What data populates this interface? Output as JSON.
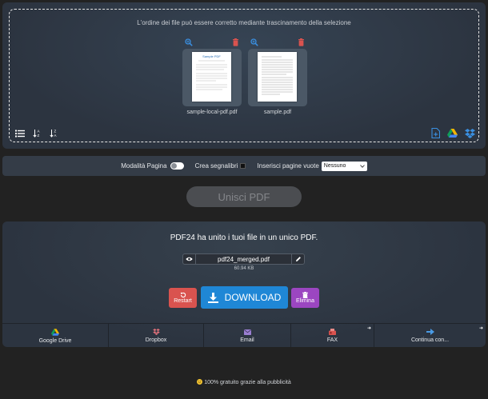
{
  "dropzone": {
    "instruction": "L'ordine dei file può essere corretto mediante trascinamento della selezione",
    "files": [
      {
        "name": "sample-local-pdf.pdf",
        "preview_title": "Sample PDF"
      },
      {
        "name": "sample.pdf",
        "preview_title": ""
      }
    ],
    "left_tools": [
      "list-view-icon",
      "sort-ascending-icon",
      "sort-descending-icon"
    ],
    "right_tools": [
      "add-file-icon",
      "google-drive-icon",
      "dropbox-icon"
    ]
  },
  "options": {
    "page_mode_label": "Modalità Pagina",
    "bookmarks_label": "Crea segnalibri",
    "blank_pages_label": "Inserisci pagine vuote",
    "blank_pages_value": "Nessuno"
  },
  "merge_button_label": "Unisci PDF",
  "result": {
    "title": "PDF24 ha unito i tuoi file in un unico PDF.",
    "filename": "pdf24_merged.pdf",
    "filesize": "60.94 KB",
    "restart_label": "Restart",
    "download_label": "DOWNLOAD",
    "delete_label": "Elimina"
  },
  "share": [
    {
      "label": "Google Drive",
      "icon": "google-drive-icon"
    },
    {
      "label": "Dropbox",
      "icon": "dropbox-icon"
    },
    {
      "label": "Email",
      "icon": "email-icon"
    },
    {
      "label": "FAX",
      "icon": "fax-icon"
    },
    {
      "label": "Continua con...",
      "icon": "arrow-right-icon"
    }
  ],
  "footer": "100% gratuito grazie alla pubblicità",
  "colors": {
    "background": "#222222",
    "panel": "#2c3440",
    "restart": "#d9534f",
    "download": "#1f87d6",
    "delete": "#9b46c1",
    "accent_icon": "#3a8fe0"
  }
}
